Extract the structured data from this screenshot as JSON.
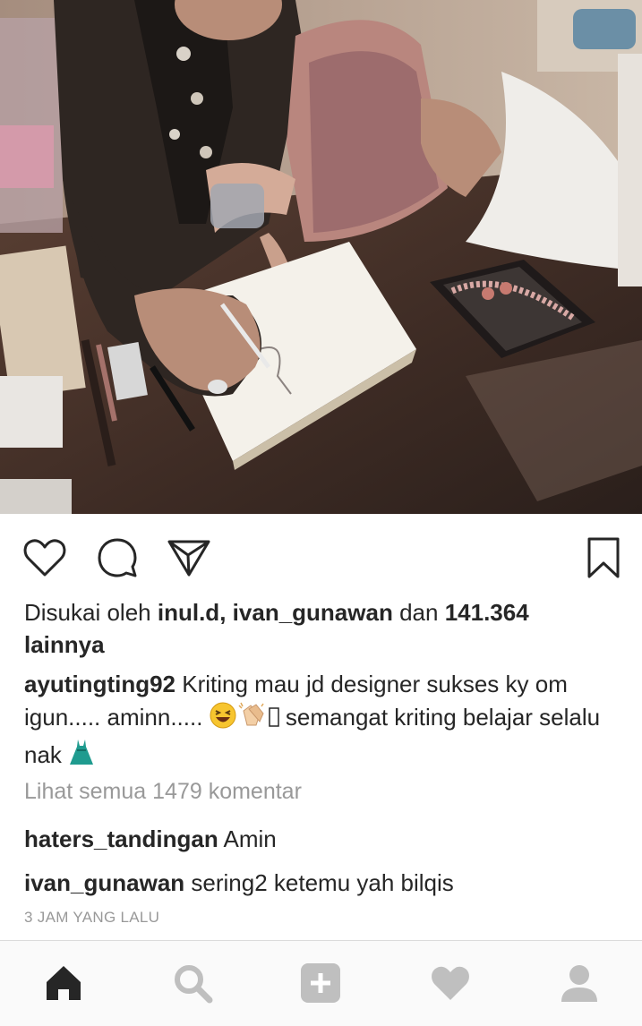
{
  "post": {
    "likes": {
      "prefix": "Disukai oleh",
      "user1": "inul.d",
      "separator": ",",
      "user2": "ivan_gunawan",
      "conjunction": "dan",
      "count": "141.364",
      "suffix": "lainnya"
    },
    "caption": {
      "username": "ayutingting92",
      "text_part1": "Kriting mau jd designer sukses ky om igun..... aminn.....",
      "text_part2": "semangat kriting belajar selalu nak"
    },
    "view_all_comments": "Lihat semua 1479 komentar",
    "comments": [
      {
        "username": "haters_tandingan",
        "text": "Amin"
      },
      {
        "username": "ivan_gunawan",
        "text": "sering2  ketemu yah bilqis"
      }
    ],
    "timestamp": "3 JAM YANG LALU"
  },
  "actions": {
    "icons": [
      "heart-outline-icon",
      "comment-bubble-icon",
      "send-paper-plane-icon",
      "bookmark-icon"
    ]
  },
  "nav": {
    "icons": [
      "home-icon",
      "search-icon",
      "add-post-icon",
      "activity-heart-icon",
      "profile-icon"
    ],
    "active": "home-icon"
  },
  "colors": {
    "text": "#262626",
    "muted": "#999999",
    "nav_bg": "#fafafa",
    "nav_icon": "#bfbfbf",
    "nav_active": "#262626"
  }
}
